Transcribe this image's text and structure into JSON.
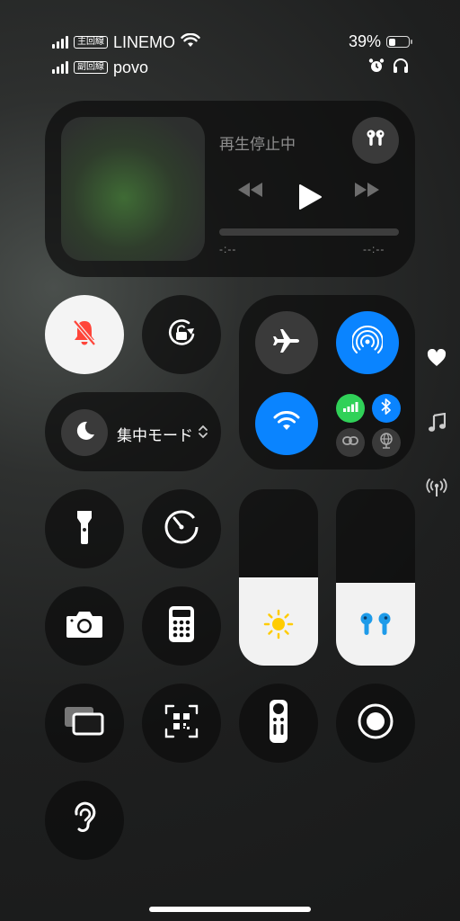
{
  "status": {
    "primary_tag": "主回線",
    "primary_carrier": "LINEMO",
    "secondary_tag": "副回線",
    "secondary_carrier": "povo",
    "battery_percent": "39%",
    "battery_level": 0.39
  },
  "now_playing": {
    "status_text": "再生停止中",
    "elapsed": "-:--",
    "remaining": "--:--",
    "progress": 0
  },
  "focus": {
    "label": "集中モード"
  },
  "sliders": {
    "brightness_level": 0.5,
    "volume_level": 0.47
  },
  "colors": {
    "accent_blue": "#0a84ff",
    "cellular_green": "#30d158",
    "silent_red": "#ff453a"
  },
  "icons": [
    "signal-bars-icon",
    "wifi-icon",
    "battery-icon",
    "alarm-icon",
    "headphones-icon",
    "airpods-icon",
    "previous-track-icon",
    "play-icon",
    "next-track-icon",
    "bell-slash-icon",
    "rotation-lock-icon",
    "airplane-icon",
    "airdrop-icon",
    "cellular-icon",
    "bluetooth-icon",
    "hotspot-link-icon",
    "vpn-globe-icon",
    "moon-icon",
    "chevron-updown-icon",
    "flashlight-icon",
    "timer-icon",
    "sun-icon",
    "camera-icon",
    "calculator-icon",
    "screen-mirroring-icon",
    "qr-scanner-icon",
    "apple-tv-remote-icon",
    "screen-record-icon",
    "hearing-icon",
    "heart-icon",
    "music-note-icon",
    "antenna-icon"
  ]
}
